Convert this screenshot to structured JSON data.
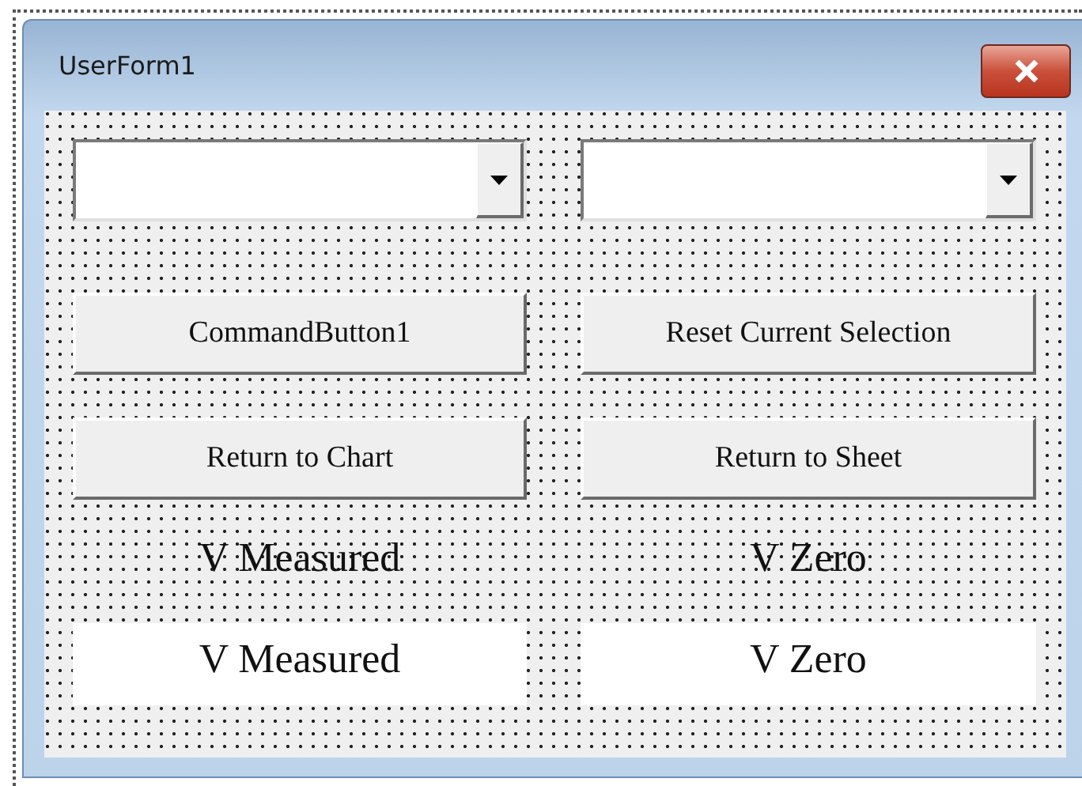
{
  "window": {
    "title": "UserForm1"
  },
  "controls": [
    {
      "kind": "combobox"
    },
    {
      "kind": "combobox"
    },
    {
      "kind": "button",
      "text": "CommandButton1"
    },
    {
      "kind": "button",
      "text": "Reset Current Selection"
    },
    {
      "kind": "button",
      "text": "Return to Chart"
    },
    {
      "kind": "button",
      "text": "Return to Sheet"
    },
    {
      "kind": "label",
      "text": "V Measured"
    },
    {
      "kind": "label",
      "text": "V Zero"
    },
    {
      "kind": "textbox",
      "text": "V Measured"
    },
    {
      "kind": "textbox",
      "text": "V Zero"
    }
  ]
}
